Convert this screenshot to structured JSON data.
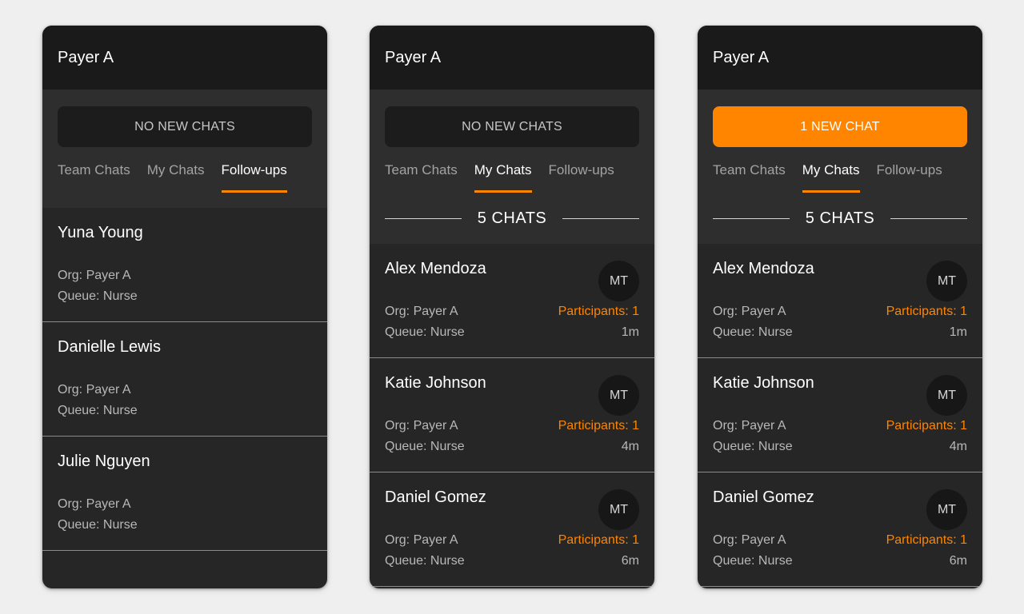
{
  "colors": {
    "accent": "#ff8500",
    "header_bg": "#1a1a1a",
    "panel_bg": "#262626",
    "page_bg": "#efefef"
  },
  "panels": [
    {
      "title": "Payer A",
      "banner": "NO NEW CHATS",
      "tabs": [
        "Team Chats",
        "My Chats",
        "Follow-ups"
      ],
      "active_tab": "Follow-ups",
      "chats": [
        {
          "name": "Yuna Young",
          "org": "Org: Payer A",
          "queue": "Queue: Nurse"
        },
        {
          "name": "Danielle Lewis",
          "org": "Org: Payer A",
          "queue": "Queue: Nurse"
        },
        {
          "name": "Julie Nguyen",
          "org": "Org: Payer A",
          "queue": "Queue: Nurse"
        }
      ]
    },
    {
      "title": "Payer A",
      "banner": "NO NEW CHATS",
      "tabs": [
        "Team Chats",
        "My Chats",
        "Follow-ups"
      ],
      "active_tab": "My Chats",
      "chat_count": "5 CHATS",
      "chats": [
        {
          "name": "Alex Mendoza",
          "org": "Org: Payer A",
          "queue": "Queue: Nurse",
          "avatar": "MT",
          "participants": "Participants: 1",
          "elapsed": "1m"
        },
        {
          "name": "Katie Johnson",
          "org": "Org: Payer A",
          "queue": "Queue: Nurse",
          "avatar": "MT",
          "participants": "Participants: 1",
          "elapsed": "4m"
        },
        {
          "name": "Daniel Gomez",
          "org": "Org: Payer A",
          "queue": "Queue: Nurse",
          "avatar": "MT",
          "participants": "Participants: 1",
          "elapsed": "6m"
        }
      ]
    },
    {
      "title": "Payer A",
      "banner": "1 NEW CHAT",
      "tabs": [
        "Team Chats",
        "My Chats",
        "Follow-ups"
      ],
      "active_tab": "My Chats",
      "chat_count": "5 CHATS",
      "chats": [
        {
          "name": "Alex Mendoza",
          "org": "Org: Payer A",
          "queue": "Queue: Nurse",
          "avatar": "MT",
          "participants": "Participants: 1",
          "elapsed": "1m"
        },
        {
          "name": "Katie Johnson",
          "org": "Org: Payer A",
          "queue": "Queue: Nurse",
          "avatar": "MT",
          "participants": "Participants: 1",
          "elapsed": "4m"
        },
        {
          "name": "Daniel Gomez",
          "org": "Org: Payer A",
          "queue": "Queue: Nurse",
          "avatar": "MT",
          "participants": "Participants: 1",
          "elapsed": "6m"
        }
      ]
    }
  ]
}
